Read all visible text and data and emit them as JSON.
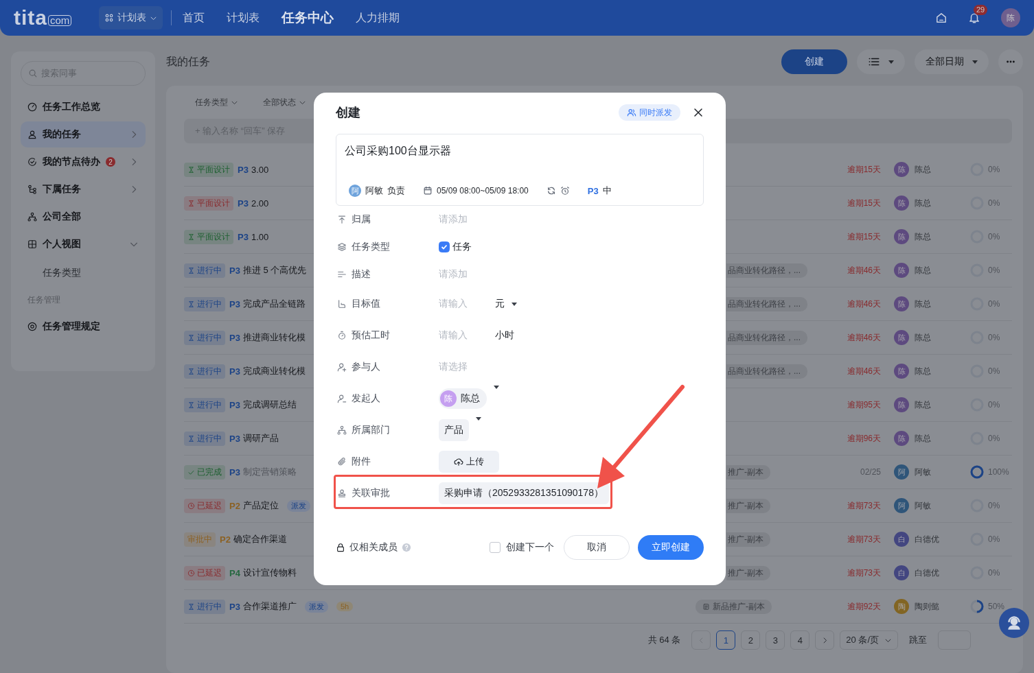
{
  "top_bar": {
    "logo": {
      "name": "tita",
      "suffix": "com"
    },
    "app_switch": "计划表",
    "nav": [
      {
        "label": "首页",
        "selected": false
      },
      {
        "label": "计划表",
        "selected": false
      },
      {
        "label": "任务中心",
        "selected": true
      },
      {
        "label": "人力排期",
        "selected": false
      }
    ],
    "notifications": "29",
    "avatar": "陈"
  },
  "sidebar": {
    "search": {
      "placeholder": "搜索同事"
    },
    "items": [
      {
        "kind": "item",
        "label": "任务工作总览",
        "selected": false
      },
      {
        "kind": "item",
        "label": "我的任务",
        "selected": true,
        "expanded": false
      },
      {
        "kind": "item",
        "label": "我的节点待办",
        "selected": false,
        "badge": "2",
        "expanded": false
      },
      {
        "kind": "item",
        "label": "下属任务",
        "selected": false,
        "expanded": false
      },
      {
        "kind": "item",
        "label": "公司全部",
        "selected": false
      },
      {
        "kind": "item",
        "label": "个人视图",
        "selected": false,
        "expanded": true
      },
      {
        "kind": "subitem",
        "label": "任务类型",
        "selected": false
      },
      {
        "kind": "section",
        "label": "任务管理"
      },
      {
        "kind": "item",
        "label": "任务管理规定",
        "selected": false
      }
    ]
  },
  "main": {
    "title": "我的任务",
    "create_button": "创建",
    "date_filter": "全部日期",
    "filters": [
      "任务类型",
      "全部状态"
    ],
    "quick_add": {
      "placeholder": "+ 输入名称 “回车” 保存"
    },
    "rows": [
      {
        "status": {
          "kind": "hourglass",
          "text": "平面设计",
          "color": "#1c5f2f"
        },
        "priority": {
          "text": "P3",
          "color": "#1c4386"
        },
        "title": "3.00",
        "tags": [],
        "due": "逾期15天",
        "overdue": true,
        "owner": {
          "avatar": "陈",
          "name": "陈总",
          "color": "#5d4a7f"
        },
        "level": 0,
        "percent": "0%"
      },
      {
        "status": {
          "kind": "hourglass",
          "text": "平面设计",
          "color": "#892b2e"
        },
        "priority": {
          "text": "P3",
          "color": "#1c4386"
        },
        "title": "2.00",
        "tags": [],
        "due": "逾期15天",
        "overdue": true,
        "owner": {
          "avatar": "陈",
          "name": "陈总",
          "color": "#5d4a7f"
        },
        "level": 0,
        "percent": "0%"
      },
      {
        "status": {
          "kind": "hourglass",
          "text": "平面设计",
          "color": "#1c5f2f"
        },
        "priority": {
          "text": "P3",
          "color": "#1c4386"
        },
        "title": "1.00",
        "tags": [],
        "due": "逾期15天",
        "overdue": true,
        "owner": {
          "avatar": "陈",
          "name": "陈总",
          "color": "#5d4a7f"
        },
        "level": 0,
        "percent": "0%"
      },
      {
        "status": {
          "kind": "hourglass",
          "text": "进行中",
          "color": "#1c4386"
        },
        "priority": {
          "text": "P3",
          "color": "#1c4386"
        },
        "title": "推进 5 个高优先",
        "tags": [],
        "project": {
          "text": "品商业转化路径，...",
          "cut": true
        },
        "due": "逾期46天",
        "overdue": true,
        "owner": {
          "avatar": "陈",
          "name": "陈总",
          "color": "#5d4a7f"
        },
        "level": 0,
        "percent": "0%"
      },
      {
        "status": {
          "kind": "hourglass",
          "text": "进行中",
          "color": "#1c4386"
        },
        "priority": {
          "text": "P3",
          "color": "#1c4386"
        },
        "title": "完成产品全链路",
        "tags": [],
        "project": {
          "text": "品商业转化路径，...",
          "cut": true
        },
        "due": "逾期46天",
        "overdue": true,
        "owner": {
          "avatar": "陈",
          "name": "陈总",
          "color": "#5d4a7f"
        },
        "level": 0,
        "percent": "0%"
      },
      {
        "status": {
          "kind": "hourglass",
          "text": "进行中",
          "color": "#1c4386"
        },
        "priority": {
          "text": "P3",
          "color": "#1c4386"
        },
        "title": "推进商业转化模",
        "tags": [],
        "project": {
          "text": "品商业转化路径，...",
          "cut": true
        },
        "due": "逾期46天",
        "overdue": true,
        "owner": {
          "avatar": "陈",
          "name": "陈总",
          "color": "#5d4a7f"
        },
        "level": 0,
        "percent": "0%"
      },
      {
        "status": {
          "kind": "hourglass",
          "text": "进行中",
          "color": "#1c4386"
        },
        "priority": {
          "text": "P3",
          "color": "#1c4386"
        },
        "title": "完成商业转化模",
        "tags": [],
        "project": {
          "text": "品商业转化路径，...",
          "cut": true
        },
        "due": "逾期46天",
        "overdue": true,
        "owner": {
          "avatar": "陈",
          "name": "陈总",
          "color": "#5d4a7f"
        },
        "level": 0,
        "percent": "0%"
      },
      {
        "status": {
          "kind": "hourglass",
          "text": "进行中",
          "color": "#1c4386"
        },
        "priority": {
          "text": "P3",
          "color": "#1c4386"
        },
        "title": "完成调研总结",
        "tags": [],
        "due": "逾期95天",
        "overdue": true,
        "owner": {
          "avatar": "陈",
          "name": "陈总",
          "color": "#5d4a7f"
        },
        "level": 0,
        "percent": "0%"
      },
      {
        "status": {
          "kind": "hourglass",
          "text": "进行中",
          "color": "#1c4386"
        },
        "priority": {
          "text": "P3",
          "color": "#1c4386"
        },
        "title": "调研产品",
        "tags": [],
        "due": "逾期96天",
        "overdue": true,
        "owner": {
          "avatar": "陈",
          "name": "陈总",
          "color": "#5d4a7f"
        },
        "level": 0,
        "percent": "0%"
      },
      {
        "status": {
          "kind": "done",
          "text": "已完成",
          "color": "#1c5f2f"
        },
        "priority": {
          "text": "P3",
          "color": "#1c4386"
        },
        "title": "制定营销策略",
        "tags": [],
        "project": {
          "text": "推广-副本",
          "cut": true
        },
        "due": "02/25",
        "overdue": false,
        "owner": {
          "avatar": "阿",
          "name": "阿敏",
          "color": "#2f5579"
        },
        "level": 1,
        "percent": "100%"
      },
      {
        "status": {
          "kind": "delayed",
          "text": "已延迟",
          "color": "#892b2e"
        },
        "priority": {
          "text": "P2",
          "color": "#8b6123"
        },
        "title": "产品定位",
        "tags": [
          {
            "kind": "dispatch",
            "text": "派发"
          }
        ],
        "project": {
          "text": "推广-副本",
          "cut": true
        },
        "due": "逾期73天",
        "overdue": true,
        "owner": {
          "avatar": "阿",
          "name": "阿敏",
          "color": "#2f5579"
        },
        "level": 0,
        "percent": "0%"
      },
      {
        "status": {
          "kind": "review",
          "text": "审批中",
          "color": "#8b6123"
        },
        "priority": {
          "text": "P2",
          "color": "#8b6123"
        },
        "title": "确定合作渠道",
        "tags": [],
        "project": {
          "text": "推广-副本",
          "cut": true
        },
        "due": "逾期73天",
        "overdue": true,
        "owner": {
          "avatar": "白",
          "name": "白德优",
          "color": "#434680"
        },
        "level": 0,
        "percent": "0%"
      },
      {
        "status": {
          "kind": "delayed",
          "text": "已延迟",
          "color": "#892b2e"
        },
        "priority": {
          "text": "P4",
          "color": "#266840"
        },
        "title": "设计宣传物料",
        "tags": [],
        "project": {
          "text": "推广-副本",
          "cut": true
        },
        "due": "逾期73天",
        "overdue": true,
        "owner": {
          "avatar": "白",
          "name": "白德优",
          "color": "#434680"
        },
        "level": 0,
        "percent": "0%"
      },
      {
        "status": {
          "kind": "hourglass",
          "text": "进行中",
          "color": "#1c4386"
        },
        "priority": {
          "text": "P3",
          "color": "#1c4386"
        },
        "title": "合作渠道推广",
        "tags": [
          {
            "kind": "dispatch",
            "text": "派发"
          },
          {
            "kind": "hours",
            "text": "5h"
          }
        ],
        "project": {
          "text": "新品推广-副本",
          "cut": false
        },
        "due": "逾期92天",
        "overdue": true,
        "owner": {
          "avatar": "陶",
          "name": "陶则懿",
          "color": "#826523"
        },
        "level": 0.5,
        "percent": "50%"
      }
    ],
    "pagination": {
      "total": "共 64 条",
      "pages": [
        {
          "label": "1",
          "selected": true
        },
        {
          "label": "2",
          "selected": false
        },
        {
          "label": "3",
          "selected": false
        },
        {
          "label": "4",
          "selected": false
        }
      ],
      "page_size": "20 条/页",
      "jump_label": "跳至"
    }
  },
  "modal": {
    "title": "创建",
    "dispatch_button": "同时派发",
    "task": {
      "title": "公司采购100台显示器",
      "owner_avatar": "阿",
      "owner": "阿敏",
      "owner_role": "负责",
      "time": "05/09 08:00~05/09 18:00",
      "priority": "P3",
      "priority_level": "中"
    },
    "fields": [
      {
        "kind": "placeholder",
        "label": "归属",
        "placeholder": "请添加"
      },
      {
        "kind": "type",
        "label": "任务类型",
        "value": "任务",
        "checked": true
      },
      {
        "kind": "placeholder",
        "label": "描述",
        "placeholder": "请添加"
      },
      {
        "kind": "input_unit",
        "label": "目标值",
        "placeholder": "请输入",
        "unit": "元",
        "dropdown": true
      },
      {
        "kind": "input_unit",
        "label": "预估工时",
        "placeholder": "请输入",
        "unit": "小时",
        "dropdown": false
      },
      {
        "kind": "placeholder",
        "label": "参与人",
        "placeholder": "请选择"
      },
      {
        "kind": "person",
        "label": "发起人",
        "avatar": "陈",
        "name": "陈总",
        "dropdown": true
      },
      {
        "kind": "chip",
        "label": "所属部门",
        "value": "产品",
        "dropdown": true,
        "highlighted": false
      },
      {
        "kind": "upload",
        "label": "附件",
        "button": "上传"
      },
      {
        "kind": "chip",
        "label": "关联审批",
        "value": "采购申请（2052933281351090178）",
        "dropdown": false,
        "highlighted": true
      }
    ],
    "footer": {
      "privacy": "仅相关成员",
      "create_next": {
        "label": "创建下一个",
        "checked": false
      },
      "cancel": "取消",
      "submit": "立即创建"
    }
  }
}
